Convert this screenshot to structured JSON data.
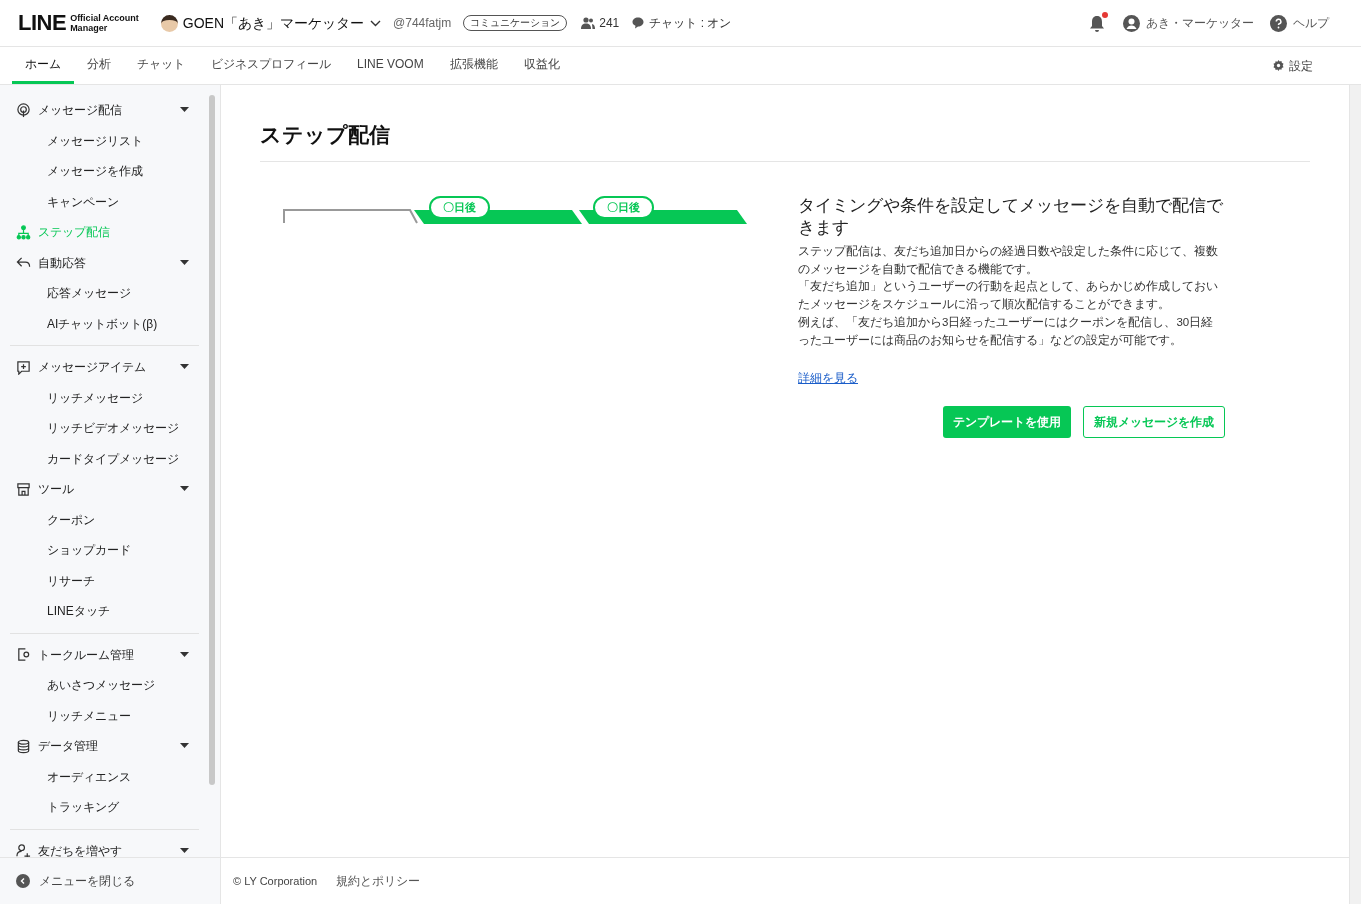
{
  "header": {
    "logo": {
      "wordmark": "LINE",
      "sub_lines": [
        "Official Account",
        "Manager"
      ]
    },
    "account": {
      "name": "GOEN「あき」マーケッター",
      "id": "@744fatjm",
      "plan_badge": "コミュニケーション",
      "friends": "241",
      "chat_status": "チャット : オン"
    },
    "notifications": {
      "unread": true
    },
    "user": "あき・マーケッター",
    "help": "ヘルプ"
  },
  "nav": {
    "tabs": [
      {
        "label": "ホーム",
        "selected": true
      },
      {
        "label": "分析",
        "selected": false
      },
      {
        "label": "チャット",
        "selected": false
      },
      {
        "label": "ビジネスプロフィール",
        "selected": false
      },
      {
        "label": "LINE VOOM",
        "selected": false
      },
      {
        "label": "拡張機能",
        "selected": false
      },
      {
        "label": "収益化",
        "selected": false
      }
    ],
    "settings": "設定"
  },
  "sidebar": {
    "sections": [
      {
        "items": [
          {
            "kind": "group",
            "label": "メッセージ配信",
            "expanded": true,
            "children": [
              {
                "label": "メッセージリスト",
                "selected": false
              },
              {
                "label": "メッセージを作成",
                "selected": false
              },
              {
                "label": "キャンペーン",
                "selected": false
              }
            ]
          },
          {
            "kind": "link",
            "label": "ステップ配信",
            "selected": true
          },
          {
            "kind": "group",
            "label": "自動応答",
            "expanded": true,
            "children": [
              {
                "label": "応答メッセージ",
                "selected": false
              },
              {
                "label": "AIチャットボット(β)",
                "selected": false
              }
            ]
          }
        ]
      },
      {
        "items": [
          {
            "kind": "group",
            "label": "メッセージアイテム",
            "expanded": true,
            "children": [
              {
                "label": "リッチメッセージ",
                "selected": false
              },
              {
                "label": "リッチビデオメッセージ",
                "selected": false
              },
              {
                "label": "カードタイプメッセージ",
                "selected": false
              }
            ]
          },
          {
            "kind": "group",
            "label": "ツール",
            "expanded": true,
            "children": [
              {
                "label": "クーポン",
                "selected": false
              },
              {
                "label": "ショップカード",
                "selected": false
              },
              {
                "label": "リサーチ",
                "selected": false
              },
              {
                "label": "LINEタッチ",
                "selected": false
              }
            ]
          }
        ]
      },
      {
        "items": [
          {
            "kind": "group",
            "label": "トークルーム管理",
            "expanded": true,
            "children": [
              {
                "label": "あいさつメッセージ",
                "selected": false
              },
              {
                "label": "リッチメニュー",
                "selected": false
              }
            ]
          },
          {
            "kind": "group",
            "label": "データ管理",
            "expanded": true,
            "children": [
              {
                "label": "オーディエンス",
                "selected": false
              },
              {
                "label": "トラッキング",
                "selected": false
              }
            ]
          }
        ]
      },
      {
        "items": [
          {
            "kind": "group",
            "label": "友だちを増やす",
            "expanded": true
          }
        ]
      }
    ],
    "close_menu": "メニューを閉じる"
  },
  "main": {
    "title": "ステップ配信",
    "diagram": {
      "badges": [
        "〇日後",
        "〇日後"
      ]
    },
    "heading": "タイミングや条件を設定してメッセージを自動で配信できます",
    "paragraphs": [
      "ステップ配信は、友だち追加日からの経過日数や設定した条件に応じて、複数のメッセージを自動で配信できる機能です。",
      "「友だち追加」というユーザーの行動を起点として、あらかじめ作成しておいたメッセージをスケジュールに沿って順次配信することができます。",
      "例えば、「友だち追加から3日経ったユーザーにはクーポンを配信し、30日経ったユーザーには商品のお知らせを配信する」などの設定が可能です。"
    ],
    "link": "詳細を見る",
    "buttons": [
      {
        "kind": "primary",
        "label": "テンプレートを使用"
      },
      {
        "kind": "secondary",
        "label": "新規メッセージを作成"
      }
    ]
  },
  "footer": {
    "copyright": "© LY Corporation",
    "links": [
      "規約とポリシー"
    ]
  }
}
